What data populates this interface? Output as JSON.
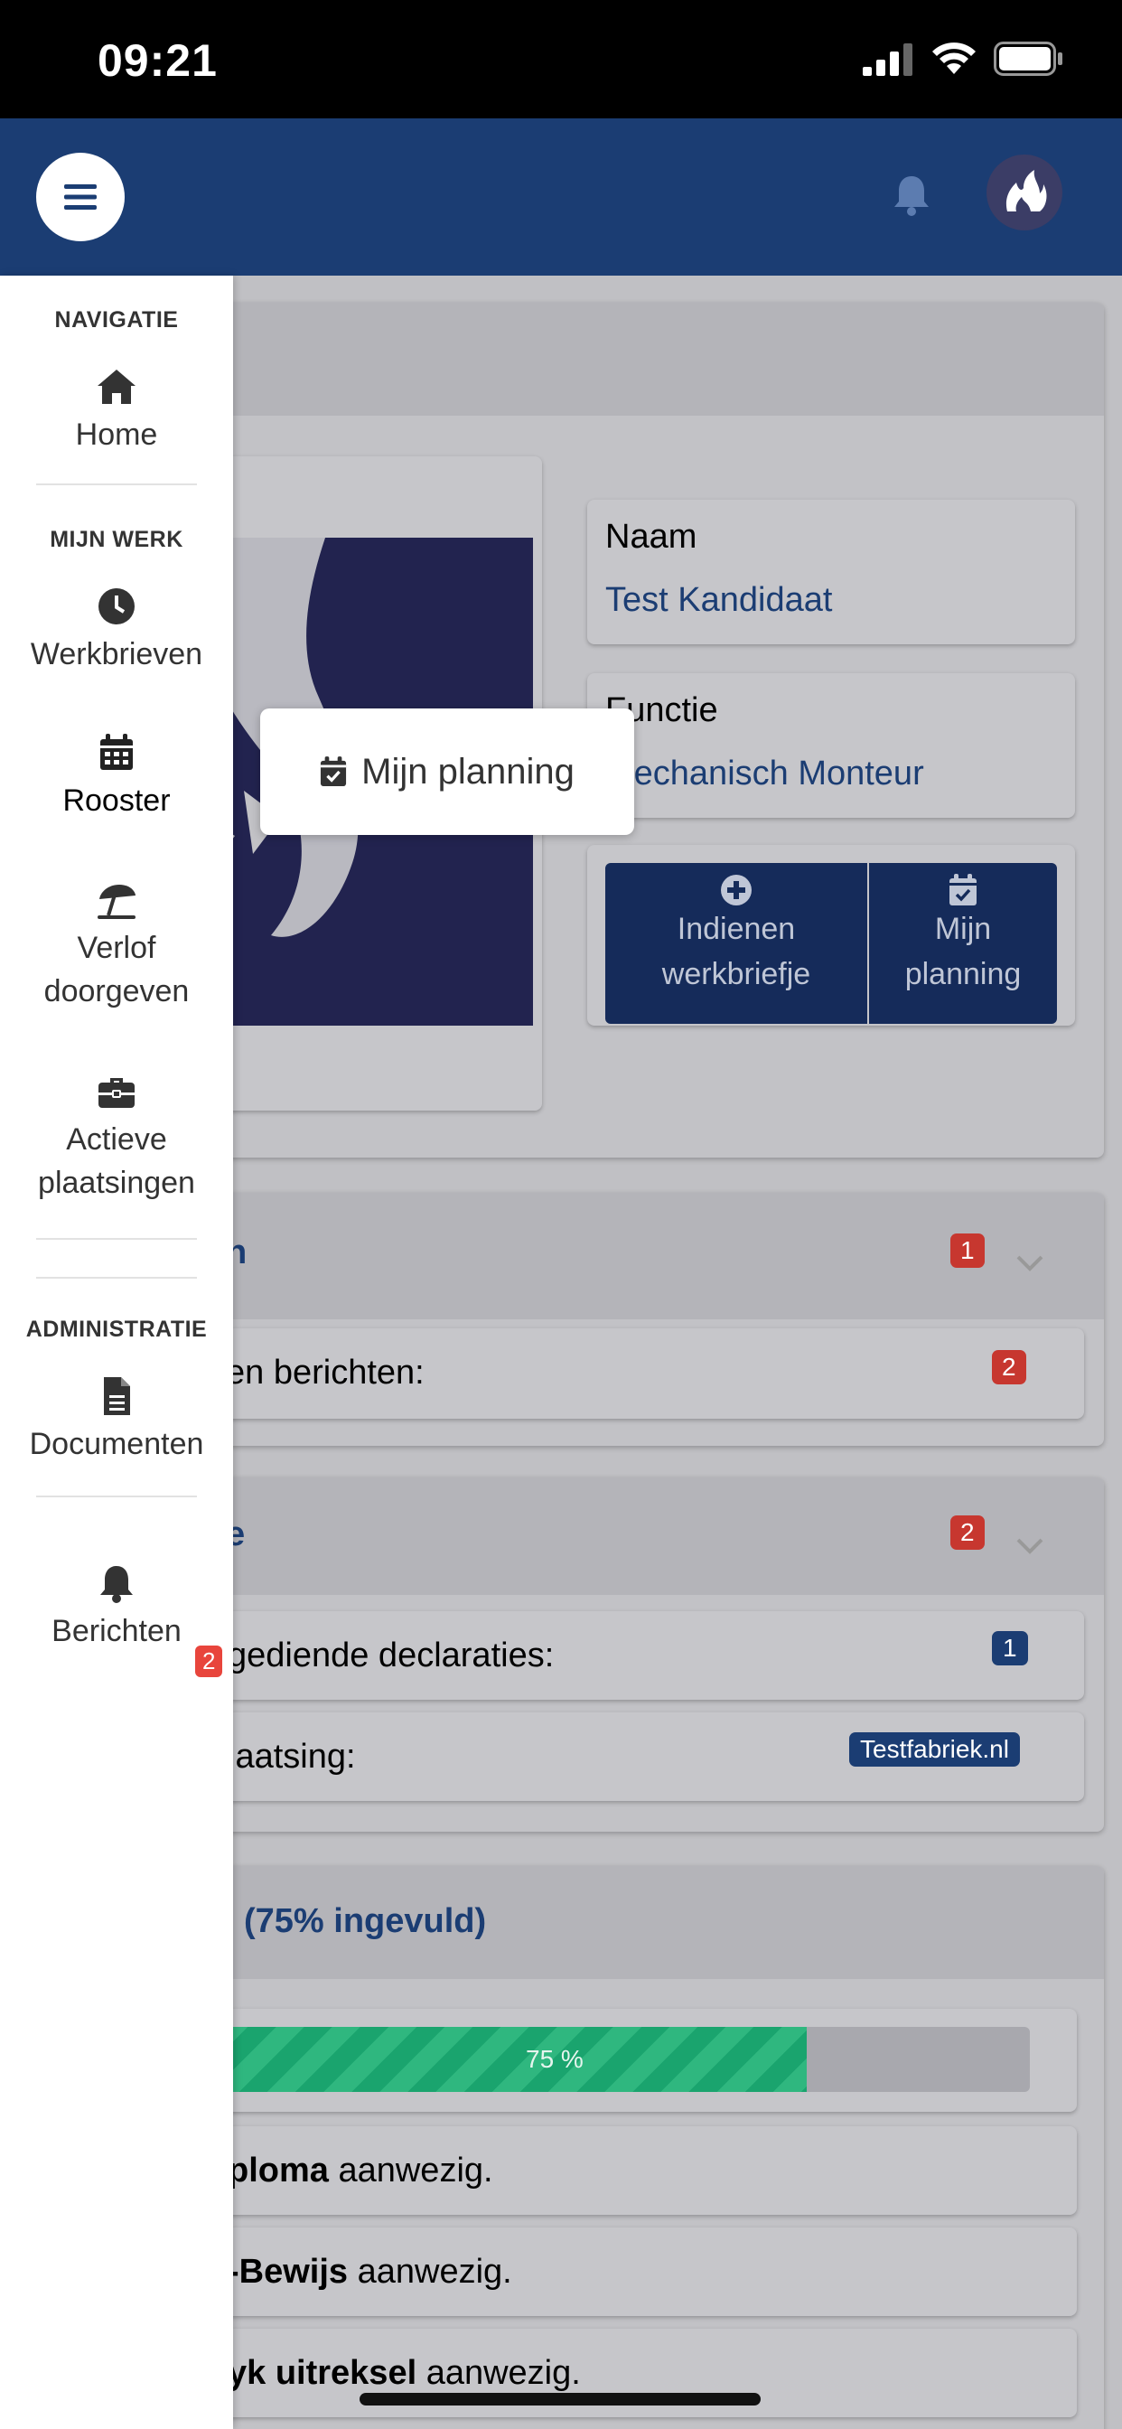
{
  "status_bar": {
    "time": "09:21"
  },
  "drawer": {
    "sections": {
      "navigatie": "NAVIGATIE",
      "mijn_werk": "MIJN WERK",
      "administratie": "ADMINISTRATIE"
    },
    "items": {
      "home": "Home",
      "werkbrieven": "Werkbrieven",
      "rooster": "Rooster",
      "verlof_1": "Verlof",
      "verlof_2": "doorgeven",
      "actieve_1": "Actieve",
      "actieve_2": "plaatsingen",
      "documenten": "Documenten",
      "berichten": "Berichten"
    },
    "berichten_badge": "2"
  },
  "tooltip": {
    "label": "Mijn planning"
  },
  "profile": {
    "naam_label": "Naam",
    "naam_value": "Test Kandidaat",
    "functie_label": "Functie",
    "functie_value": "Mechanisch Monteur",
    "btn_werkbriefje_1": "Indienen",
    "btn_werkbriefje_2": "werkbriefje",
    "btn_planning_1": "Mijn",
    "btn_planning_2": "planning"
  },
  "messages_card": {
    "title_fragment": "n",
    "badge": "1",
    "row_label": "en berichten:",
    "row_badge": "2"
  },
  "admin_card": {
    "title_fragment": "e",
    "badge": "2",
    "row1_label": "gediende declaraties:",
    "row1_badge": "1",
    "row2_label": "laatsing:",
    "row2_badge": "Testfabriek.nl"
  },
  "documents_card": {
    "title": "(75% ingevuld)",
    "progress": 75,
    "progress_label": "75 %",
    "items": [
      {
        "bold": "ploma",
        "rest": " aanwezig."
      },
      {
        "bold": "-Bewijs",
        "rest": " aanwezig."
      },
      {
        "bold": "yk uitreksel",
        "rest": " aanwezig."
      }
    ]
  }
}
